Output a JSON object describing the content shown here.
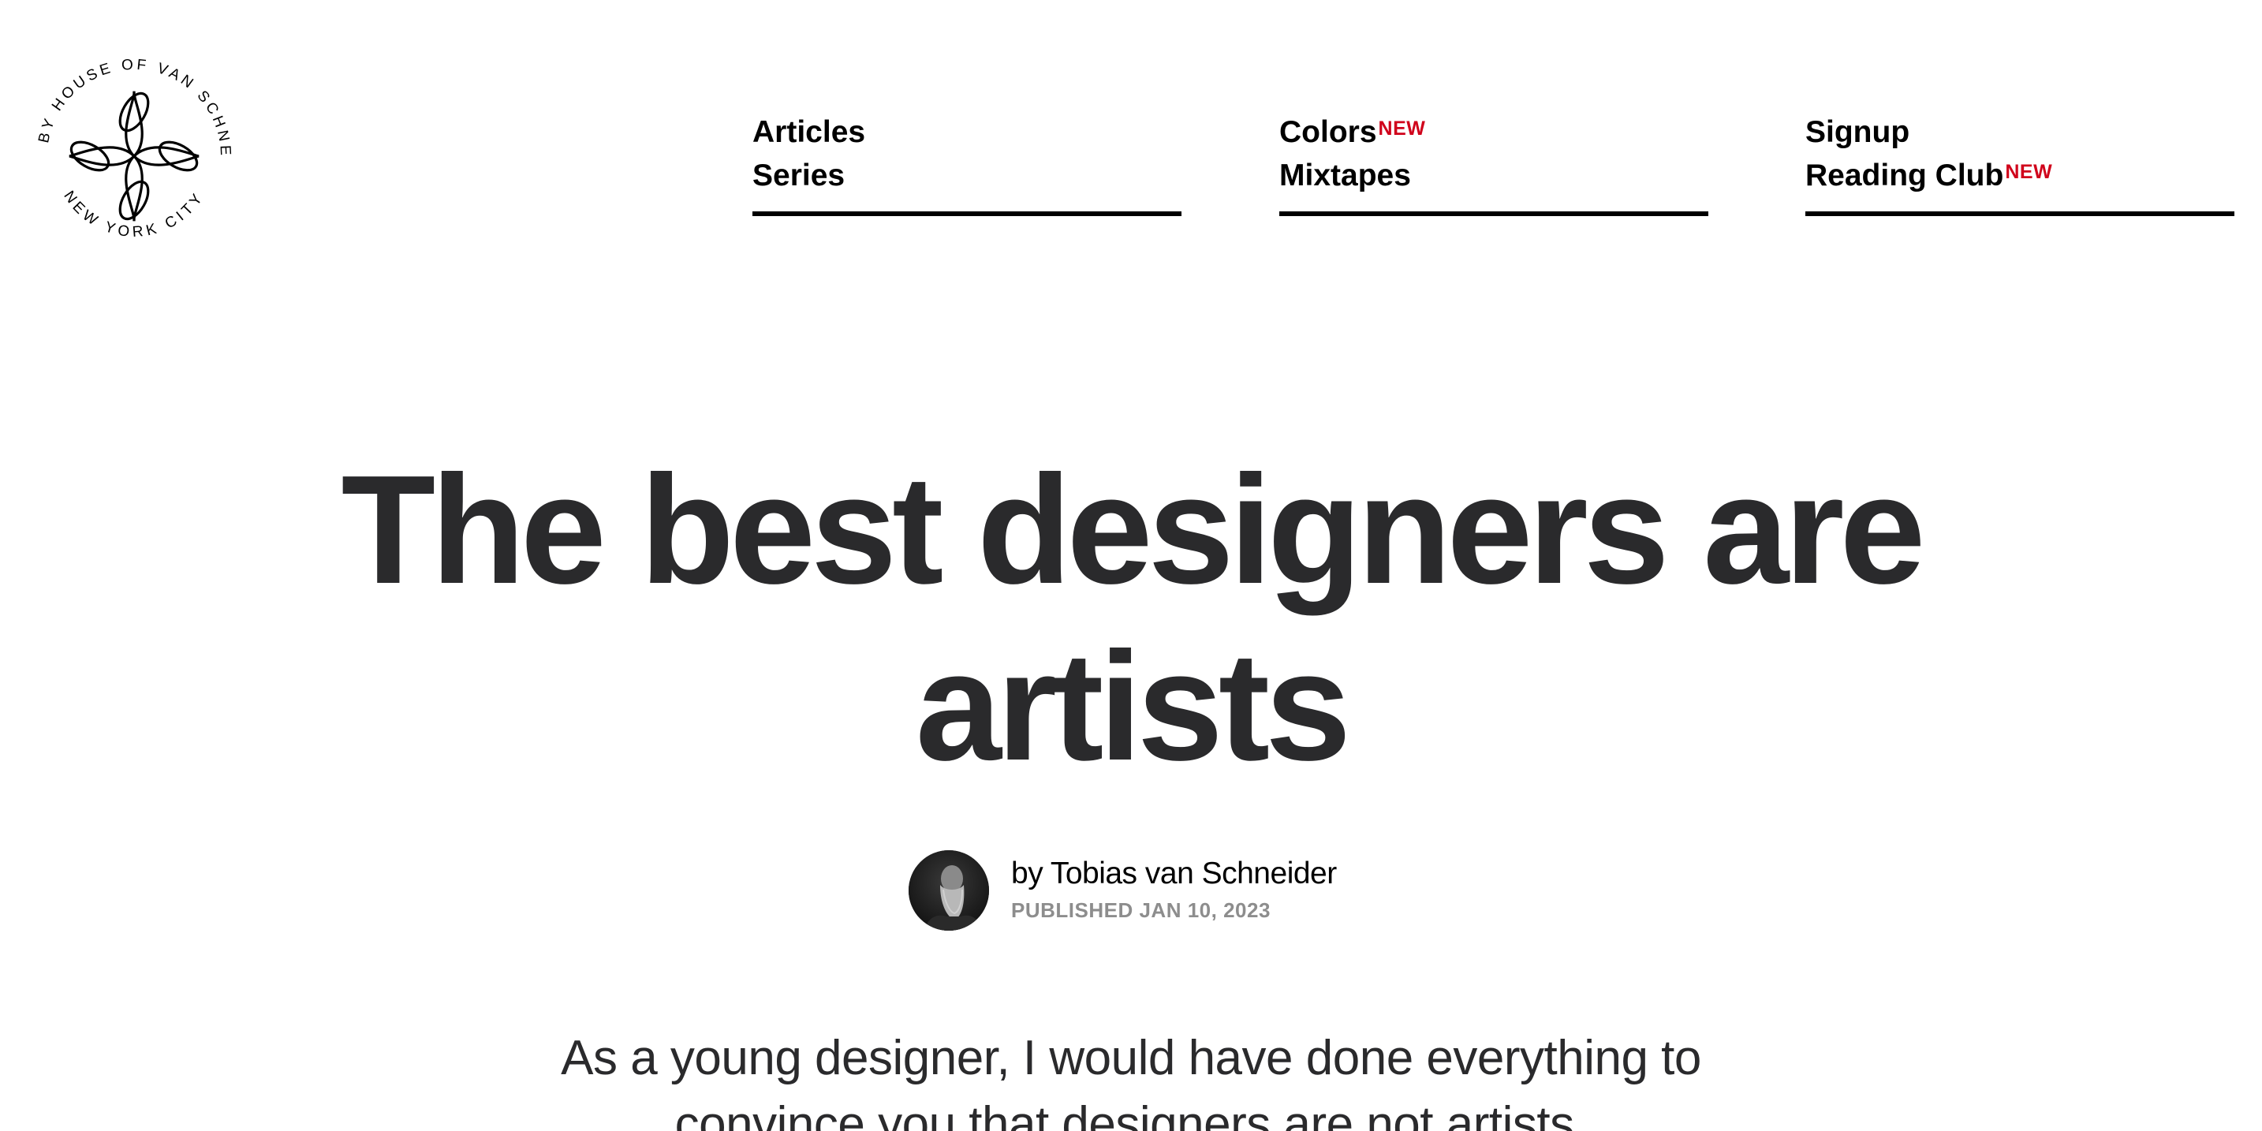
{
  "logo": {
    "ring_top": "MADE BY HOUSE OF VAN SCHNEIDER",
    "ring_bottom": "NEW YORK CITY",
    "icon": "quatrefoil-knot-icon"
  },
  "nav": {
    "badge_color": "#d0021b",
    "columns": [
      {
        "links": [
          {
            "label": "Articles",
            "badge": ""
          },
          {
            "label": "Series",
            "badge": ""
          }
        ]
      },
      {
        "links": [
          {
            "label": "Colors",
            "badge": "NEW"
          },
          {
            "label": "Mixtapes",
            "badge": ""
          }
        ]
      },
      {
        "links": [
          {
            "label": "Signup",
            "badge": ""
          },
          {
            "label": "Reading Club",
            "badge": "NEW"
          }
        ]
      }
    ]
  },
  "article": {
    "title_line1": "The best designers are",
    "title_line2": "artists",
    "author": "by Tobias van Schneider",
    "published": "PUBLISHED JAN 10, 2023",
    "intro_line1": "As a young designer, I would have done everything to",
    "intro_line2": "convince you that designers are not artists."
  },
  "colors": {
    "text_dark": "#2a2a2c",
    "meta_gray": "#8d8d8d"
  }
}
